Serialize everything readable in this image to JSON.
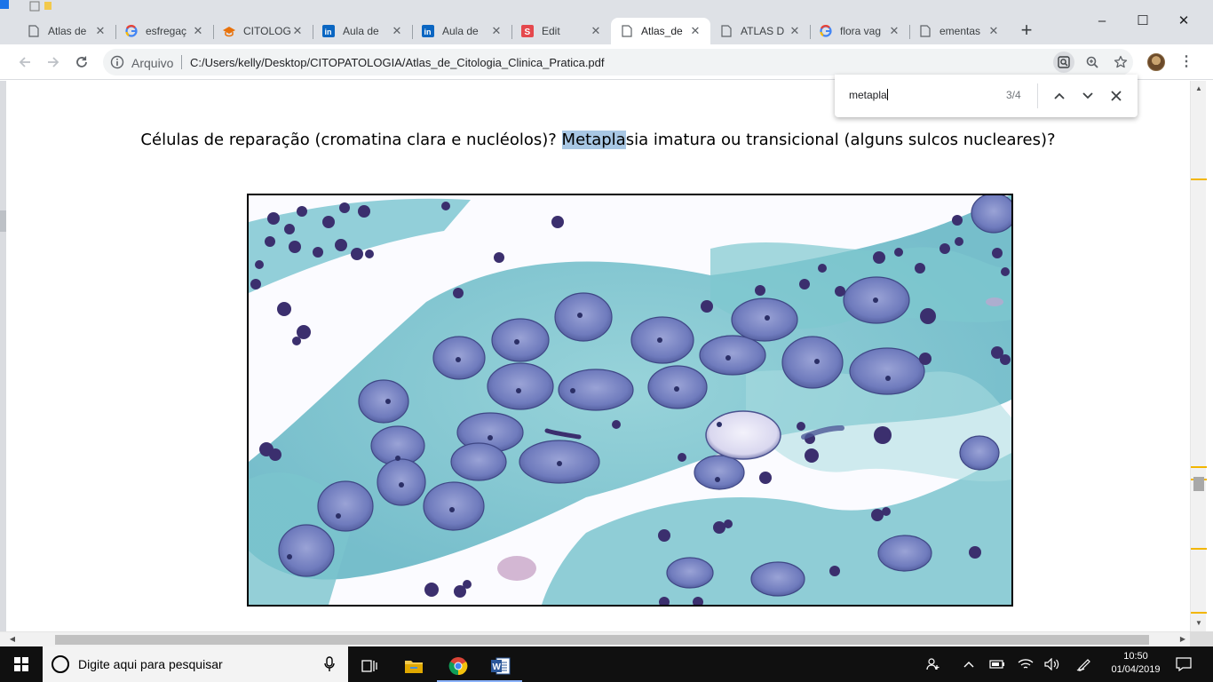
{
  "browser": {
    "tabs": [
      {
        "title": "Atlas de",
        "icon": "document-icon",
        "active": false
      },
      {
        "title": "esfregaç",
        "icon": "google-icon",
        "active": false
      },
      {
        "title": "CITOLOG",
        "icon": "graduation-cap-icon",
        "active": false
      },
      {
        "title": "Aula de",
        "icon": "linkedin-icon",
        "active": false
      },
      {
        "title": "Aula de",
        "icon": "linkedin-icon",
        "active": false
      },
      {
        "title": "Edit",
        "icon": "slides-icon",
        "active": false
      },
      {
        "title": "Atlas_de",
        "icon": "document-icon",
        "active": true
      },
      {
        "title": "ATLAS D",
        "icon": "document-icon",
        "active": false
      },
      {
        "title": "flora vag",
        "icon": "google-icon",
        "active": false
      },
      {
        "title": "ementas",
        "icon": "document-icon",
        "active": false
      }
    ],
    "new_tab": "+",
    "window_controls": {
      "minimize": "–",
      "maximize": "☐",
      "close": "✕"
    },
    "omnibox": {
      "security_label": "Arquivo",
      "url": "C:/Users/kelly/Desktop/CITOPATOLOGIA/Atlas_de_Citologia_Clinica_Pratica.pdf"
    }
  },
  "find_bar": {
    "query": "metapla",
    "count": "3/4"
  },
  "document": {
    "caption_before": "Células de reparação (cromatina clara e nucléolos)? ",
    "caption_match": "Metapla",
    "caption_after": "sia imatura ou transicional (alguns sulcos nucleares)?"
  },
  "taskbar": {
    "search_placeholder": "Digite aqui para pesquisar",
    "time": "10:50",
    "date": "01/04/2019"
  },
  "colors": {
    "find_highlight": "#a8c7e4",
    "tabstrip_bg": "#dee1e6",
    "stain_cyan": "#7cc6d0",
    "stain_nucleus": "#6a74b8"
  }
}
